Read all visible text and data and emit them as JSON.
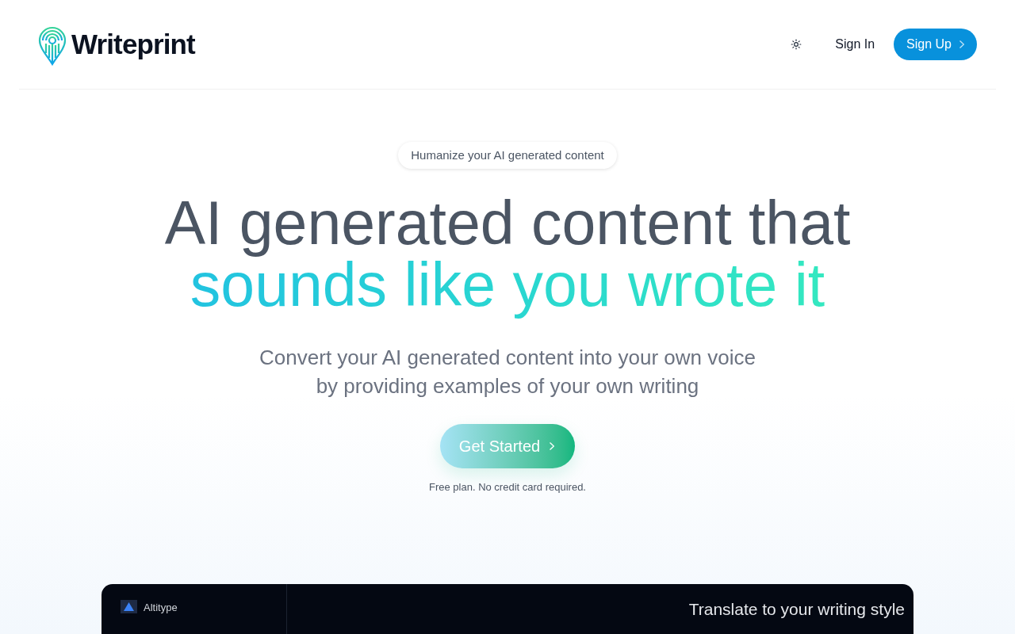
{
  "header": {
    "brand": "Writeprint",
    "sign_in": "Sign In",
    "sign_up": "Sign Up"
  },
  "hero": {
    "badge": "Humanize your AI generated content",
    "title_line1": "AI generated content that",
    "title_line2": "sounds like you wrote it",
    "subtitle_line1": "Convert your AI generated content into your own voice",
    "subtitle_line2": "by providing examples of your own writing",
    "cta": "Get Started",
    "note": "Free plan. No credit card required."
  },
  "preview": {
    "app_name": "Altitype",
    "heading": "Translate to your writing style"
  }
}
